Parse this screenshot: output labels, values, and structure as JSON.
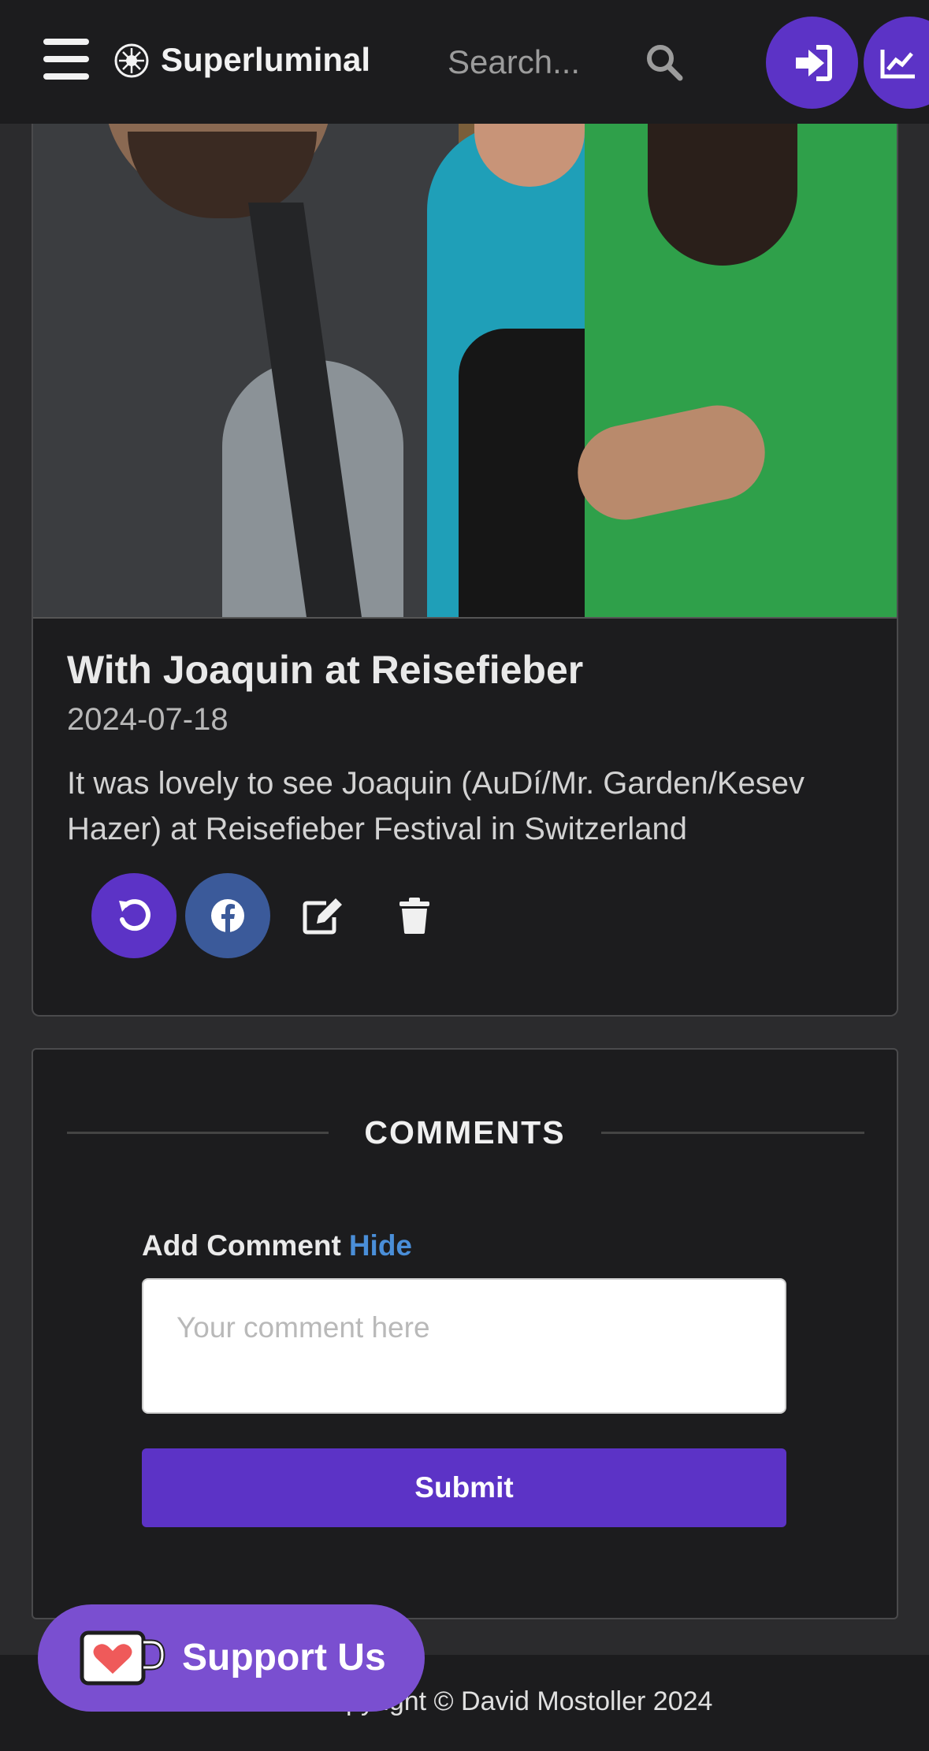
{
  "navbar": {
    "brand_name": "Superluminal",
    "search_placeholder": "Search..."
  },
  "post": {
    "title": "With Joaquin at Reisefieber",
    "date": "2024-07-18",
    "description": "It was lovely to see Joaquin (AuDí/Mr. Garden/Kesev Hazer) at Reisefieber Festival in Switzerland"
  },
  "comments": {
    "heading": "COMMENTS",
    "add_label": "Add Comment",
    "hide_label": "Hide",
    "input_placeholder": "Your comment here",
    "submit_label": "Submit"
  },
  "support": {
    "label": "Support Us"
  },
  "footer": {
    "copyright": "Copyright © David Mostoller 2024"
  },
  "colors": {
    "accent": "#5c33c6",
    "facebook": "#3b5a9a",
    "link": "#4a8ed8",
    "support": "#7a4fd0"
  },
  "icons": [
    "hamburger-menu-icon",
    "brand-logo-icon",
    "search-icon",
    "sign-in-icon",
    "chart-icon",
    "undo-icon",
    "facebook-icon",
    "edit-icon",
    "trash-icon",
    "heart-mug-icon"
  ]
}
